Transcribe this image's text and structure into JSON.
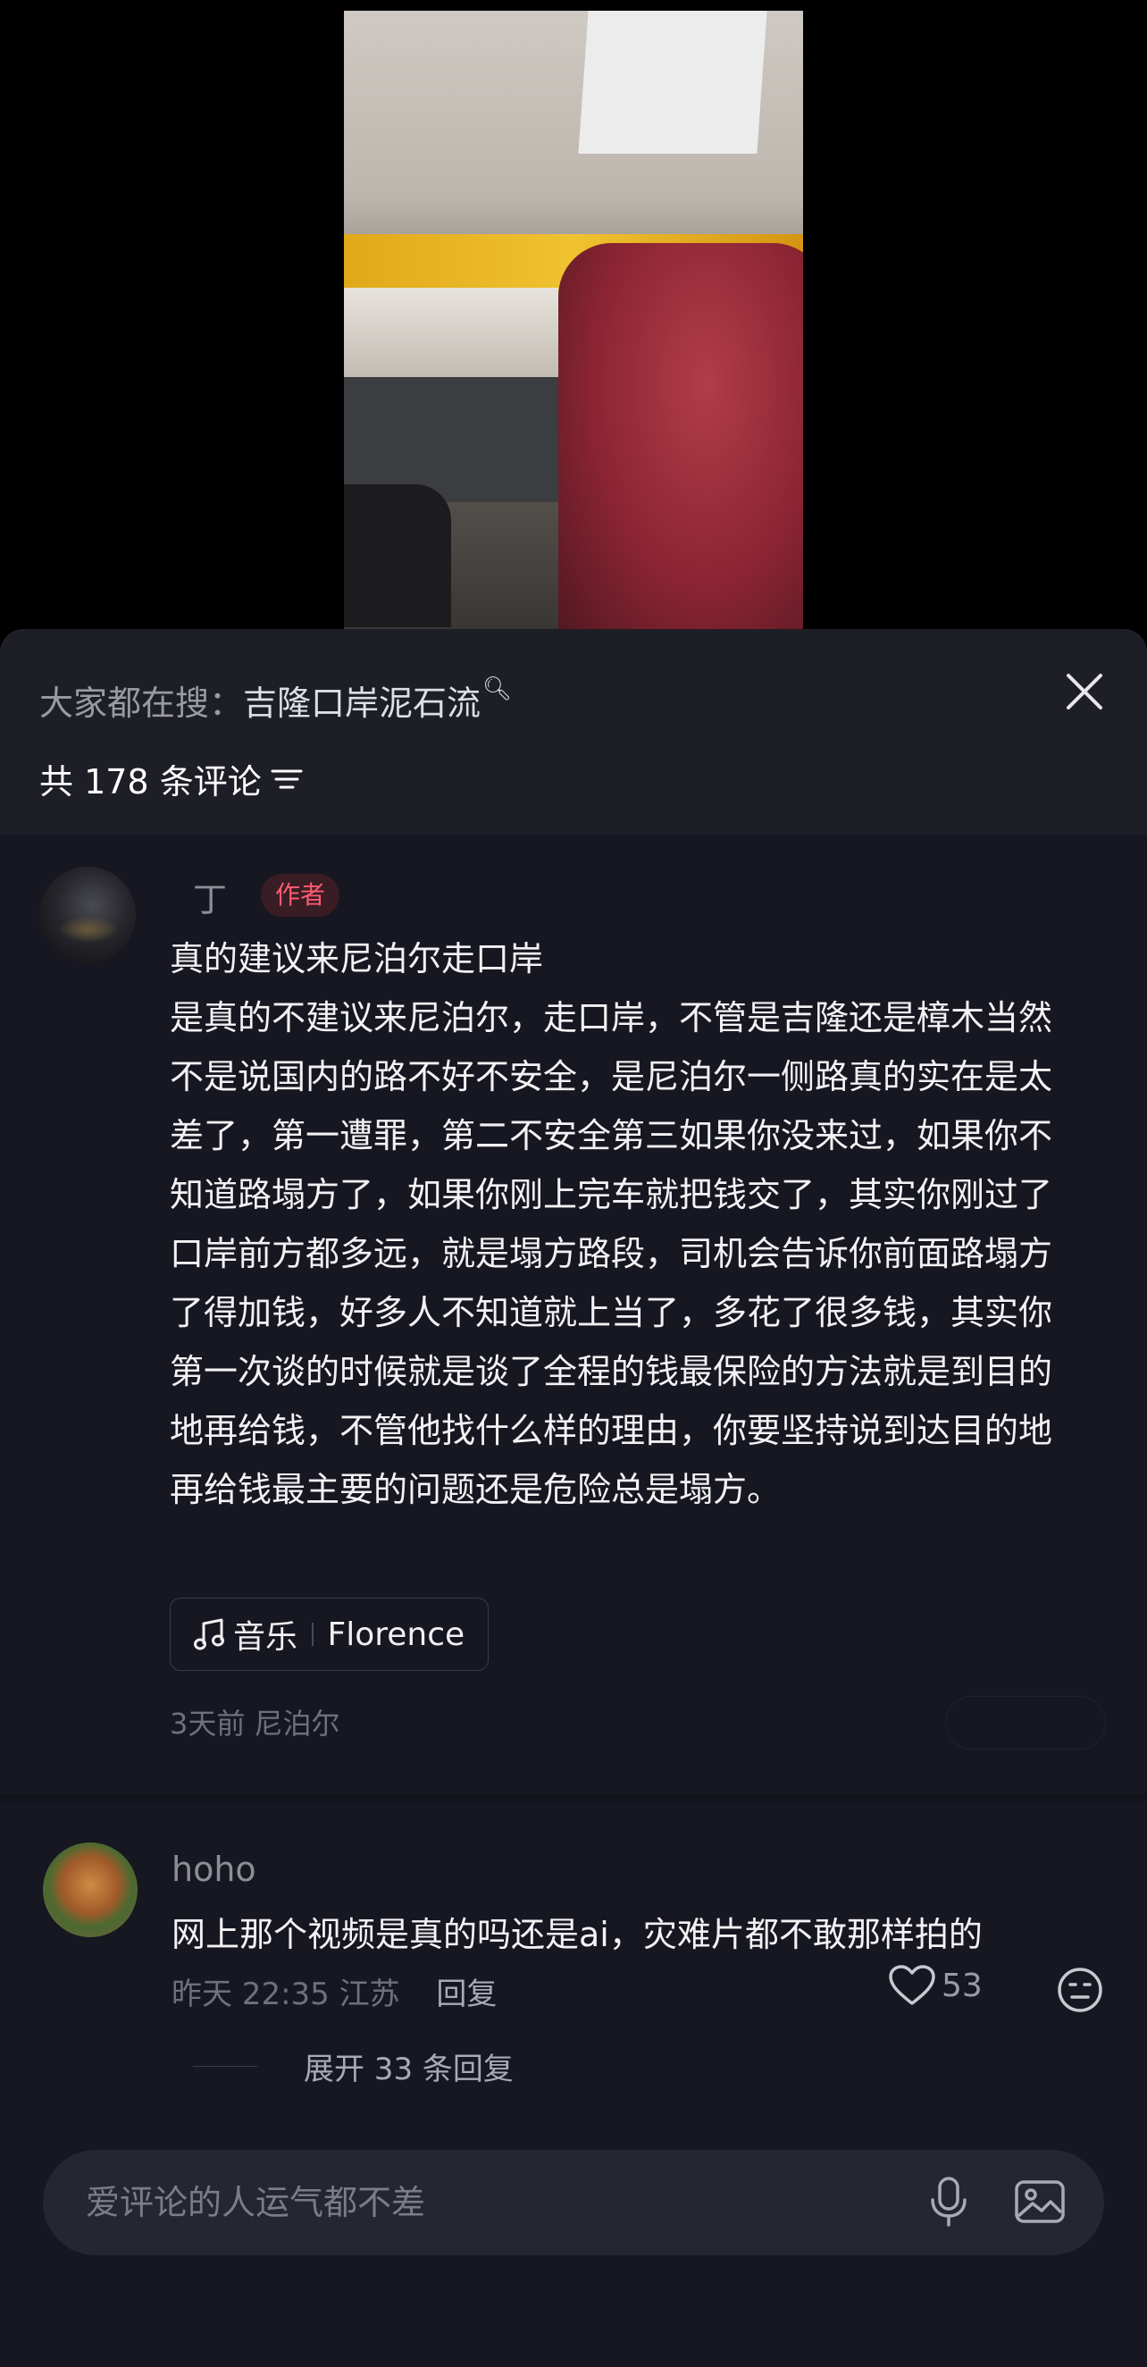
{
  "search": {
    "prefix": "大家都在搜：",
    "keyword": "吉隆口岸泥石流"
  },
  "comments_header": {
    "count_label": "共 178 条评论"
  },
  "comments": [
    {
      "user": "丁",
      "tag": "作者",
      "text": "真的建议来尼泊尔走口岸\n是真的不建议来尼泊尔，走口岸，不管是吉隆还是樟木当然不是说国内的路不好不安全，是尼泊尔一侧路真的实在是太差了，第一遭罪，第二不安全第三如果你没来过，如果你不知道路塌方了，如果你刚上完车就把钱交了，其实你刚过了口岸前方都多远，就是塌方路段，司机会告诉你前面路塌方了得加钱，好多人不知道就上当了，多花了很多钱，其实你第一次谈的时候就是谈了全程的钱最保险的方法就是到目的地再给钱，不管他找什么样的理由，你要坚持说到达目的地再给钱最主要的问题还是危险总是塌方。",
      "music": {
        "label": "音乐",
        "title": "Florence"
      },
      "time": "3天前",
      "location": "尼泊尔"
    },
    {
      "user": "hoho",
      "text": "网上那个视频是真的吗还是ai，灾难片都不敢那样拍的",
      "time": "昨天 22:35",
      "location": "江苏",
      "reply_label": "回复",
      "likes": "53",
      "expand_label": "展开 33 条回复"
    }
  ],
  "input": {
    "placeholder": "爱评论的人运气都不差"
  }
}
